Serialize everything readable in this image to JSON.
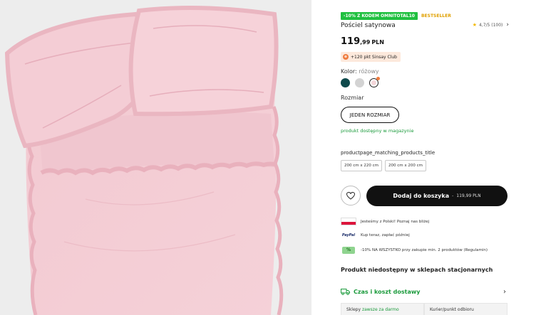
{
  "badges": {
    "promo": "-10% Z KODEM OMNITOTAL10",
    "bestseller": "BESTSELLER"
  },
  "rating": {
    "value": "4,7/5 (100)",
    "icon": "star-icon"
  },
  "product": {
    "title": "Pościel satynowa",
    "price_int": "119",
    "price_dec": ",99",
    "currency": "PLN"
  },
  "club": {
    "text": "+120 pkt Sinsay Club"
  },
  "color": {
    "label": "Kolor:",
    "value": "różowy",
    "swatches": [
      "#0e4a4c",
      "#d3d3d3",
      "#f4d6d9"
    ],
    "selected_index": 2
  },
  "size": {
    "label": "Rozmiar",
    "option": "JEDEN ROZMIAR"
  },
  "availability": "produkt dostępny w magazynie",
  "matching": {
    "title": "productpage_matching_products_title",
    "chips": [
      "200 cm x 220 cm",
      "200 cm x 200 cm"
    ]
  },
  "cart": {
    "label": "Dodaj do koszyka",
    "separator": "-",
    "amount": "119,99 PLN"
  },
  "features": [
    {
      "icon": "poland-flag-icon",
      "text": "Jesteśmy z Polski! Poznaj nas bliżej"
    },
    {
      "icon": "paypal-icon",
      "icon_text": "PayPal",
      "text": "Kup teraz, zapłać później"
    },
    {
      "icon": "discount-tag-icon",
      "text": "-10% NA WSZYSTKO przy zakupie min. 2 produktów (Regulamin)"
    }
  ],
  "unavailable_text": "Produkt niedostępny w sklepach stacjonarnych",
  "delivery": {
    "label": "Czas i koszt dostawy",
    "columns": [
      {
        "prefix": "Sklepy",
        "highlight": "zawsze za darmo"
      },
      {
        "prefix": "Kurier/punkt odbioru",
        "highlight": ""
      }
    ]
  },
  "colors": {
    "accent_green": "#1a9a3b",
    "promo_green": "#20c040",
    "bestseller": "#e0a000",
    "primary_button": "#111111"
  }
}
